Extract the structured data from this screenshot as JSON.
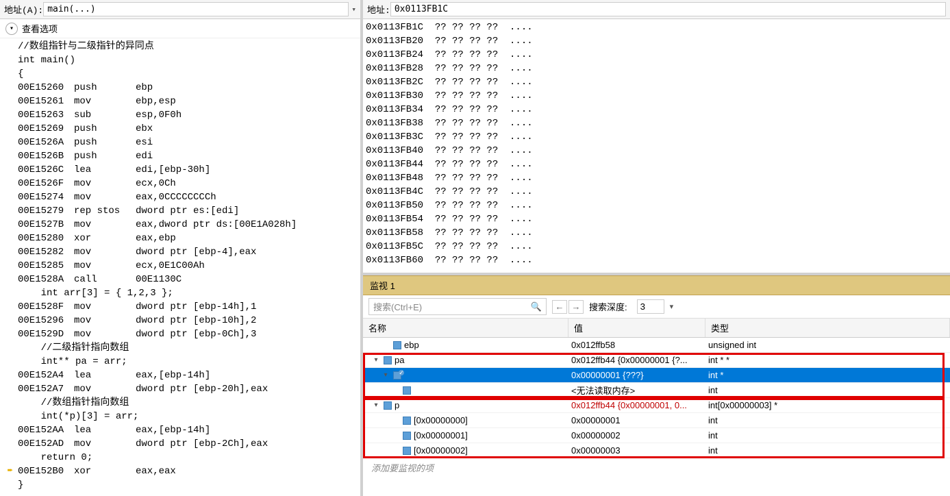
{
  "left": {
    "addrLabel": "地址(A):",
    "addrValue": "main(...)",
    "viewOptions": "查看选项",
    "lines": [
      {
        "gutter": "",
        "text": "//数组指针与二级指针的异同点"
      },
      {
        "gutter": "",
        "text": "int main()"
      },
      {
        "gutter": "",
        "text": "{"
      },
      {
        "gutter": "",
        "addr": "00E15260",
        "op": "push",
        "args": "ebp"
      },
      {
        "gutter": "",
        "addr": "00E15261",
        "op": "mov",
        "args": "ebp,esp"
      },
      {
        "gutter": "",
        "addr": "00E15263",
        "op": "sub",
        "args": "esp,0F0h"
      },
      {
        "gutter": "",
        "addr": "00E15269",
        "op": "push",
        "args": "ebx"
      },
      {
        "gutter": "",
        "addr": "00E1526A",
        "op": "push",
        "args": "esi"
      },
      {
        "gutter": "",
        "addr": "00E1526B",
        "op": "push",
        "args": "edi"
      },
      {
        "gutter": "",
        "addr": "00E1526C",
        "op": "lea",
        "args": "edi,[ebp-30h]"
      },
      {
        "gutter": "",
        "addr": "00E1526F",
        "op": "mov",
        "args": "ecx,0Ch"
      },
      {
        "gutter": "",
        "addr": "00E15274",
        "op": "mov",
        "args": "eax,0CCCCCCCCh"
      },
      {
        "gutter": "",
        "addr": "00E15279",
        "op": "rep stos",
        "args": "dword ptr es:[edi]"
      },
      {
        "gutter": "",
        "addr": "00E1527B",
        "op": "mov",
        "args": "eax,dword ptr ds:[00E1A028h]"
      },
      {
        "gutter": "",
        "addr": "00E15280",
        "op": "xor",
        "args": "eax,ebp"
      },
      {
        "gutter": "",
        "addr": "00E15282",
        "op": "mov",
        "args": "dword ptr [ebp-4],eax"
      },
      {
        "gutter": "",
        "addr": "00E15285",
        "op": "mov",
        "args": "ecx,0E1C00Ah"
      },
      {
        "gutter": "",
        "addr": "00E1528A",
        "op": "call",
        "args": "00E1130C"
      },
      {
        "gutter": "",
        "text": "    int arr[3] = { 1,2,3 };"
      },
      {
        "gutter": "",
        "addr": "00E1528F",
        "op": "mov",
        "args": "dword ptr [ebp-14h],1"
      },
      {
        "gutter": "",
        "addr": "00E15296",
        "op": "mov",
        "args": "dword ptr [ebp-10h],2"
      },
      {
        "gutter": "",
        "addr": "00E1529D",
        "op": "mov",
        "args": "dword ptr [ebp-0Ch],3"
      },
      {
        "gutter": "",
        "text": "    //二级指针指向数组"
      },
      {
        "gutter": "",
        "text": "    int** pa = arr;"
      },
      {
        "gutter": "",
        "addr": "00E152A4",
        "op": "lea",
        "args": "eax,[ebp-14h]"
      },
      {
        "gutter": "",
        "addr": "00E152A7",
        "op": "mov",
        "args": "dword ptr [ebp-20h],eax"
      },
      {
        "gutter": "",
        "text": "    //数组指针指向数组"
      },
      {
        "gutter": "",
        "text": "    int(*p)[3] = arr;"
      },
      {
        "gutter": "",
        "addr": "00E152AA",
        "op": "lea",
        "args": "eax,[ebp-14h]"
      },
      {
        "gutter": "",
        "addr": "00E152AD",
        "op": "mov",
        "args": "dword ptr [ebp-2Ch],eax"
      },
      {
        "gutter": "",
        "text": "    return 0;"
      },
      {
        "gutter": "➨",
        "addr": "00E152B0",
        "op": "xor",
        "args": "eax,eax"
      },
      {
        "gutter": "",
        "text": "}"
      }
    ]
  },
  "mem": {
    "addrLabel": "地址:",
    "addrValue": "0x0113FB1C",
    "rows": [
      {
        "a": "0x0113FB1C",
        "b": "?? ?? ?? ??",
        "c": "...."
      },
      {
        "a": "0x0113FB20",
        "b": "?? ?? ?? ??",
        "c": "...."
      },
      {
        "a": "0x0113FB24",
        "b": "?? ?? ?? ??",
        "c": "...."
      },
      {
        "a": "0x0113FB28",
        "b": "?? ?? ?? ??",
        "c": "...."
      },
      {
        "a": "0x0113FB2C",
        "b": "?? ?? ?? ??",
        "c": "...."
      },
      {
        "a": "0x0113FB30",
        "b": "?? ?? ?? ??",
        "c": "...."
      },
      {
        "a": "0x0113FB34",
        "b": "?? ?? ?? ??",
        "c": "...."
      },
      {
        "a": "0x0113FB38",
        "b": "?? ?? ?? ??",
        "c": "...."
      },
      {
        "a": "0x0113FB3C",
        "b": "?? ?? ?? ??",
        "c": "...."
      },
      {
        "a": "0x0113FB40",
        "b": "?? ?? ?? ??",
        "c": "...."
      },
      {
        "a": "0x0113FB44",
        "b": "?? ?? ?? ??",
        "c": "...."
      },
      {
        "a": "0x0113FB48",
        "b": "?? ?? ?? ??",
        "c": "...."
      },
      {
        "a": "0x0113FB4C",
        "b": "?? ?? ?? ??",
        "c": "...."
      },
      {
        "a": "0x0113FB50",
        "b": "?? ?? ?? ??",
        "c": "...."
      },
      {
        "a": "0x0113FB54",
        "b": "?? ?? ?? ??",
        "c": "...."
      },
      {
        "a": "0x0113FB58",
        "b": "?? ?? ?? ??",
        "c": "...."
      },
      {
        "a": "0x0113FB5C",
        "b": "?? ?? ?? ??",
        "c": "...."
      },
      {
        "a": "0x0113FB60",
        "b": "?? ?? ?? ??",
        "c": "...."
      }
    ]
  },
  "watch": {
    "title": "监视 1",
    "searchPlaceholder": "搜索(Ctrl+E)",
    "depthLabel": "搜索深度:",
    "depthValue": "3",
    "headers": {
      "name": "名称",
      "value": "值",
      "type": "类型"
    },
    "rows": [
      {
        "indent": 1,
        "exp": "",
        "name": "ebp",
        "val": "0x012ffb58",
        "type": "unsigned int",
        "sel": false
      },
      {
        "indent": 0,
        "exp": "▾",
        "name": "pa",
        "val": "0x012ffb44 {0x00000001 {?...",
        "type": "int * *",
        "sel": false
      },
      {
        "indent": 1,
        "exp": "▾",
        "check": true,
        "name": "",
        "val": "0x00000001 {???}",
        "type": "int *",
        "sel": true
      },
      {
        "indent": 2,
        "exp": "",
        "name": "",
        "val": "<无法读取内存>",
        "type": "int",
        "sel": false
      },
      {
        "indent": 0,
        "exp": "▾",
        "name": "p",
        "val": "0x012ffb44 {0x00000001, 0...",
        "type": "int[0x00000003] *",
        "sel": false,
        "redval": true
      },
      {
        "indent": 2,
        "exp": "",
        "name": "[0x00000000]",
        "val": "0x00000001",
        "type": "int",
        "sel": false
      },
      {
        "indent": 2,
        "exp": "",
        "name": "[0x00000001]",
        "val": "0x00000002",
        "type": "int",
        "sel": false
      },
      {
        "indent": 2,
        "exp": "",
        "name": "[0x00000002]",
        "val": "0x00000003",
        "type": "int",
        "sel": false
      }
    ],
    "addItem": "添加要监视的项"
  }
}
